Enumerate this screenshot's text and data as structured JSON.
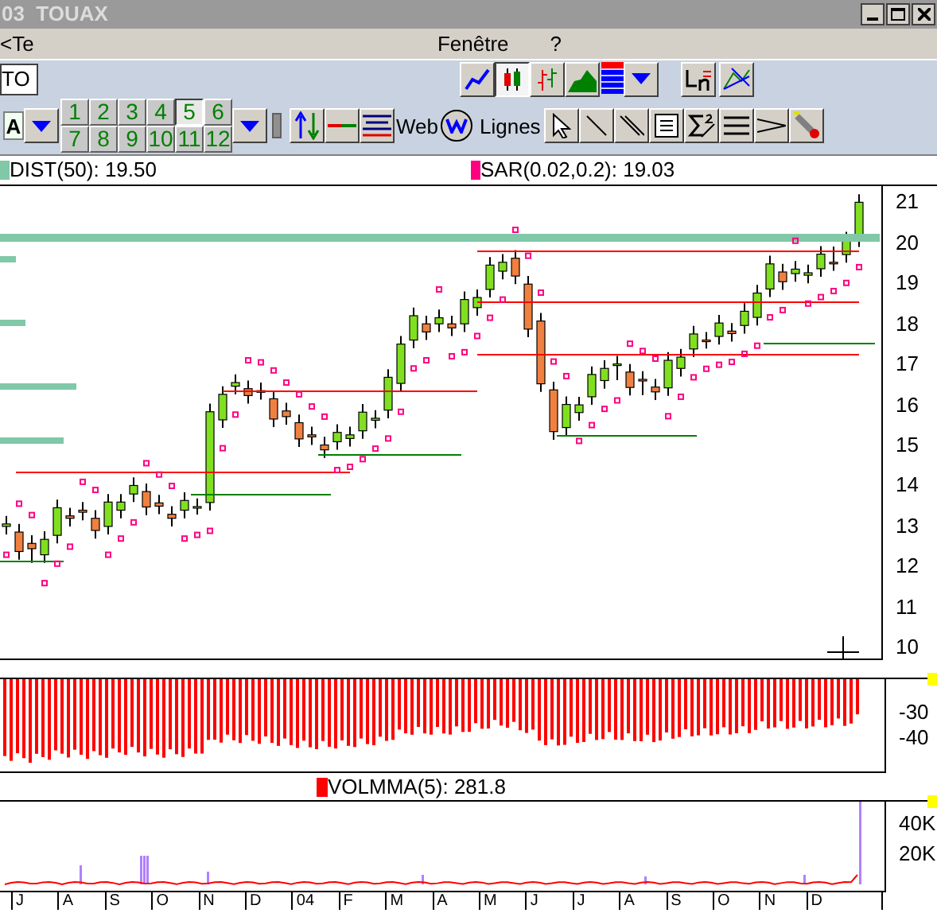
{
  "window": {
    "title": "03  TOUAX"
  },
  "menu": [
    {
      "label": "<Te"
    },
    {
      "label": "Fenêtre"
    },
    {
      "label": "?"
    }
  ],
  "symbol_field": {
    "value": "TO"
  },
  "chart_types": [
    {
      "kind": "line",
      "selected": false
    },
    {
      "kind": "candle",
      "selected": true
    },
    {
      "kind": "bar",
      "selected": false
    },
    {
      "kind": "area",
      "selected": false
    }
  ],
  "font_box": "A",
  "periods": [
    {
      "label": "1",
      "selected": false
    },
    {
      "label": "2",
      "selected": false
    },
    {
      "label": "3",
      "selected": false
    },
    {
      "label": "4",
      "selected": false
    },
    {
      "label": "5",
      "selected": true
    },
    {
      "label": "6",
      "selected": false
    },
    {
      "label": "7",
      "selected": false
    },
    {
      "label": "8",
      "selected": false
    },
    {
      "label": "9",
      "selected": false
    },
    {
      "label": "10",
      "selected": false
    },
    {
      "label": "11",
      "selected": false
    },
    {
      "label": "12",
      "selected": false
    }
  ],
  "web_label": "Web",
  "lines_label": "Lignes",
  "legend": [
    {
      "label": "DIST(50): 19.50",
      "color": "#80c8a8"
    },
    {
      "label": "SAR(0.02,0.2): 19.03",
      "color": "#ff0080"
    }
  ],
  "price_chart": {
    "chart_data": {
      "type": "candlestick",
      "ylim": [
        9.7,
        21.4
      ],
      "yticks": [
        21,
        20,
        19,
        18,
        17,
        16,
        15,
        14,
        13,
        12,
        11,
        10
      ],
      "ohlc": [
        [
          13.0,
          13.26,
          12.8,
          13.06
        ],
        [
          12.86,
          13.06,
          12.18,
          12.38
        ],
        [
          12.58,
          12.78,
          12.1,
          12.45
        ],
        [
          12.3,
          12.88,
          12.1,
          12.68
        ],
        [
          12.78,
          13.66,
          12.58,
          13.46
        ],
        [
          13.26,
          13.46,
          13.0,
          13.2
        ],
        [
          13.4,
          13.6,
          13.15,
          13.35
        ],
        [
          13.2,
          13.4,
          12.7,
          12.9
        ],
        [
          13.0,
          13.8,
          12.8,
          13.6
        ],
        [
          13.4,
          13.8,
          13.2,
          13.6
        ],
        [
          13.8,
          14.21,
          13.6,
          14.01
        ],
        [
          13.86,
          14.06,
          13.28,
          13.48
        ],
        [
          13.58,
          13.78,
          13.3,
          13.5
        ],
        [
          13.3,
          13.5,
          13.0,
          13.2
        ],
        [
          13.4,
          13.84,
          13.2,
          13.64
        ],
        [
          13.49,
          13.69,
          13.29,
          13.49
        ],
        [
          13.59,
          16.03,
          13.39,
          15.83
        ],
        [
          15.63,
          16.46,
          15.43,
          16.26
        ],
        [
          16.46,
          16.75,
          16.26,
          16.55
        ],
        [
          16.4,
          16.6,
          16.03,
          16.23
        ],
        [
          16.33,
          16.55,
          16.13,
          16.35
        ],
        [
          16.15,
          16.35,
          15.45,
          15.65
        ],
        [
          15.85,
          16.05,
          15.51,
          15.71
        ],
        [
          15.56,
          15.76,
          14.96,
          15.16
        ],
        [
          15.26,
          15.46,
          15.01,
          15.21
        ],
        [
          15.01,
          15.21,
          14.69,
          14.89
        ],
        [
          15.09,
          15.52,
          14.89,
          15.32
        ],
        [
          15.17,
          15.46,
          14.97,
          15.26
        ],
        [
          15.36,
          16.02,
          15.16,
          15.82
        ],
        [
          15.62,
          15.87,
          15.42,
          15.67
        ],
        [
          15.87,
          16.88,
          15.67,
          16.68
        ],
        [
          16.53,
          17.7,
          16.33,
          17.5
        ],
        [
          17.6,
          18.4,
          17.4,
          18.2
        ],
        [
          18.0,
          18.2,
          17.6,
          17.8
        ],
        [
          18.0,
          18.35,
          17.8,
          18.15
        ],
        [
          18.0,
          18.2,
          17.7,
          17.9
        ],
        [
          18.0,
          18.8,
          17.8,
          18.6
        ],
        [
          18.4,
          18.85,
          18.2,
          18.65
        ],
        [
          18.85,
          19.65,
          18.65,
          19.45
        ],
        [
          19.3,
          19.72,
          19.1,
          19.52
        ],
        [
          19.62,
          19.82,
          18.98,
          19.18
        ],
        [
          18.98,
          19.18,
          17.67,
          17.87
        ],
        [
          18.07,
          18.27,
          16.32,
          16.52
        ],
        [
          16.37,
          16.57,
          15.14,
          15.34
        ],
        [
          15.44,
          16.21,
          15.24,
          16.01
        ],
        [
          15.81,
          16.2,
          15.61,
          16.0
        ],
        [
          16.2,
          16.95,
          16.0,
          16.75
        ],
        [
          16.6,
          17.1,
          16.4,
          16.9
        ],
        [
          17.0,
          17.21,
          16.61,
          17.01
        ],
        [
          16.81,
          17.01,
          16.23,
          16.43
        ],
        [
          16.63,
          16.83,
          16.24,
          16.59
        ],
        [
          16.44,
          16.64,
          16.12,
          16.32
        ],
        [
          16.42,
          17.3,
          16.22,
          17.1
        ],
        [
          16.9,
          17.38,
          16.7,
          17.18
        ],
        [
          17.38,
          17.95,
          17.18,
          17.75
        ],
        [
          17.6,
          17.8,
          17.39,
          17.59
        ],
        [
          17.69,
          18.22,
          17.49,
          18.02
        ],
        [
          17.82,
          18.02,
          17.56,
          17.76
        ],
        [
          17.96,
          18.51,
          17.76,
          18.31
        ],
        [
          18.16,
          18.96,
          17.96,
          18.76
        ],
        [
          18.86,
          19.68,
          18.66,
          19.48
        ],
        [
          19.28,
          19.48,
          18.84,
          19.04
        ],
        [
          19.24,
          19.55,
          19.04,
          19.35
        ],
        [
          19.2,
          19.46,
          19.0,
          19.26
        ],
        [
          19.36,
          19.92,
          19.16,
          19.72
        ],
        [
          19.52,
          19.91,
          19.31,
          19.51
        ],
        [
          19.71,
          20.27,
          19.51,
          20.07
        ],
        [
          20.05,
          21.2,
          19.9,
          21.0
        ]
      ]
    }
  },
  "oscillator_axis": [
    "-30",
    "-40"
  ],
  "volume_legend": {
    "label": "VOLMMA(5): 281.8",
    "color": "#ff0000"
  },
  "volume_axis": [
    "40K",
    "20K"
  ],
  "months": [
    "J",
    "A",
    "S",
    "O",
    "N",
    "D",
    "04",
    "F",
    "M",
    "A",
    "M",
    "J",
    "J",
    "A",
    "S",
    "O",
    "N",
    "D"
  ]
}
